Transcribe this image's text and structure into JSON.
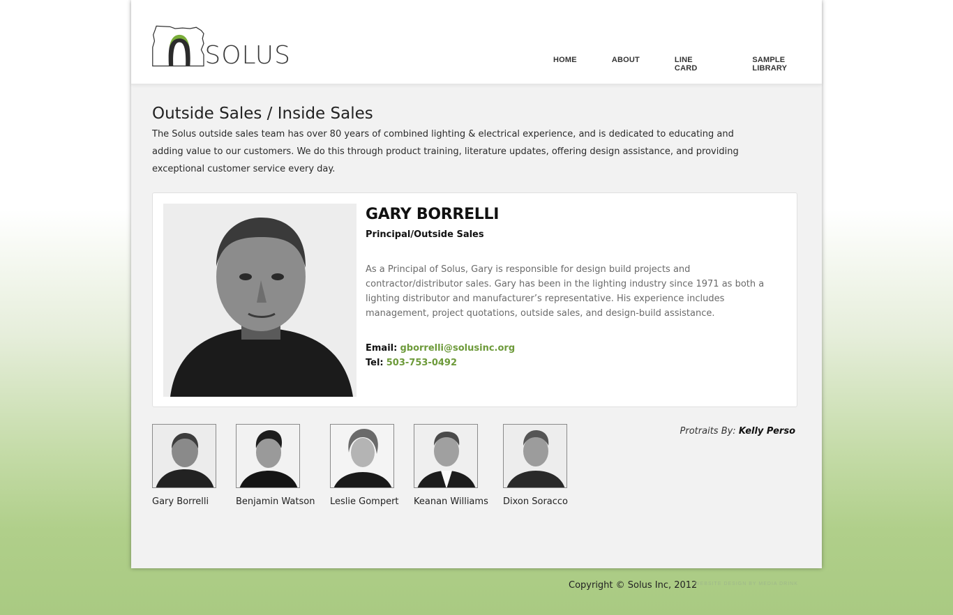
{
  "brand": {
    "name": "SOLUS",
    "accent_color": "#6d9a3a"
  },
  "nav": {
    "items": [
      {
        "label": "HOME"
      },
      {
        "label": "ABOUT"
      },
      {
        "label": "LINE CARD"
      },
      {
        "label": "SAMPLE LIBRARY"
      }
    ]
  },
  "main": {
    "title": "Outside Sales / Inside Sales",
    "intro": "The Solus outside sales team has over 80 years of combined lighting & electrical experience, and is dedicated to educating and adding value to our customers. We do this through product training, literature updates, offering design assistance, and providing exceptional customer service every day."
  },
  "profile": {
    "name": "GARY BORRELLI",
    "role": "Principal/Outside Sales",
    "bio": "As a Principal of Solus, Gary is responsible for design build projects and contractor/distributor sales. Gary has been in the lighting industry since 1971 as both a lighting distributor and manufacturer’s representative. His experience includes management, project quotations, outside sales, and design-build assistance.",
    "email_label": "Email:",
    "email": "gborrelli@solusinc.org",
    "tel_label": "Tel:",
    "tel": "503-753-0492"
  },
  "team": [
    {
      "name": "Gary Borrelli"
    },
    {
      "name": "Benjamin Watson"
    },
    {
      "name": "Leslie Gompert"
    },
    {
      "name": "Keanan Williams"
    },
    {
      "name": "Dixon Soracco"
    }
  ],
  "credit": {
    "prefix": "Protraits By:",
    "name": "Kelly Perso"
  },
  "footer": {
    "copyright": "Copyright © Solus Inc, 2012",
    "design_credit": "WEBSITE DESIGN BY MEDIA DRINK"
  }
}
